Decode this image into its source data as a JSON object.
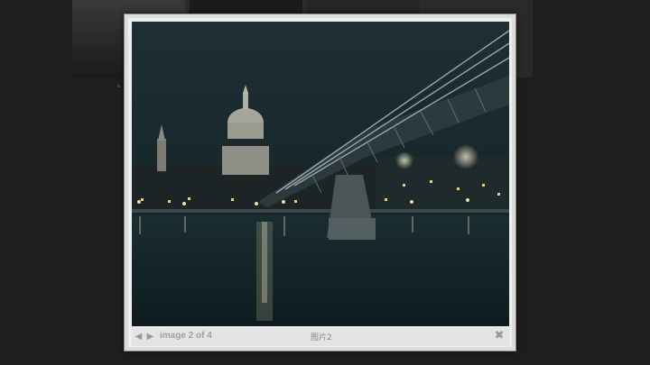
{
  "lightbox": {
    "counter": "image 2 of 4",
    "caption": "图片2",
    "close_icon": "close-icon",
    "prev_icon": "arrow-left-icon",
    "next_icon": "arrow-right-icon",
    "prev_glyph": "◀",
    "next_glyph": "▶",
    "close_glyph": "✖"
  },
  "colors": {
    "overlay": "#1e1e1e",
    "frame": "#dcdcdc",
    "footer": "#e4e4e4",
    "footer_text": "#a0a0a0"
  }
}
